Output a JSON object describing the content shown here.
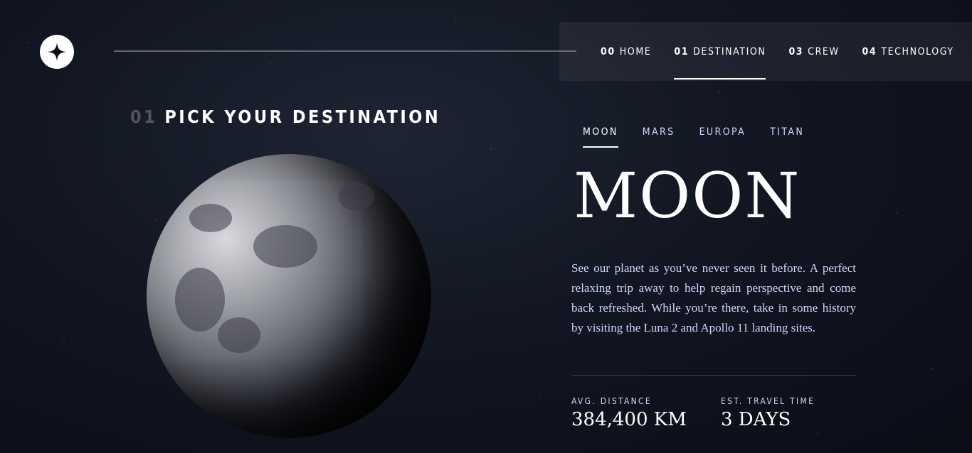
{
  "nav": {
    "items": [
      {
        "num": "00",
        "label": "HOME"
      },
      {
        "num": "01",
        "label": "DESTINATION"
      },
      {
        "num": "03",
        "label": "CREW"
      },
      {
        "num": "04",
        "label": "TECHNOLOGY"
      }
    ],
    "active_index": 1
  },
  "heading": {
    "num": "01",
    "title": "PICK YOUR DESTINATION"
  },
  "destination_tabs": [
    "MOON",
    "MARS",
    "EUROPA",
    "TITAN"
  ],
  "active_tab": "MOON",
  "planet": {
    "name": "MOON",
    "description": "See our planet as you’ve never seen it before. A perfect relaxing trip away to help regain perspective and come back refreshed. While you’re there, take in some history by visiting the Luna 2 and Apollo 11 landing sites.",
    "stats": [
      {
        "label": "AVG. DISTANCE",
        "value": "384,400 KM"
      },
      {
        "label": "EST. TRAVEL TIME",
        "value": "3 DAYS"
      }
    ]
  },
  "colors": {
    "background": "#0b0d17",
    "accent": "#d0d6f9",
    "white": "#ffffff"
  },
  "icons": {
    "logo": "four-point-star-icon",
    "planet": "moon-image"
  }
}
